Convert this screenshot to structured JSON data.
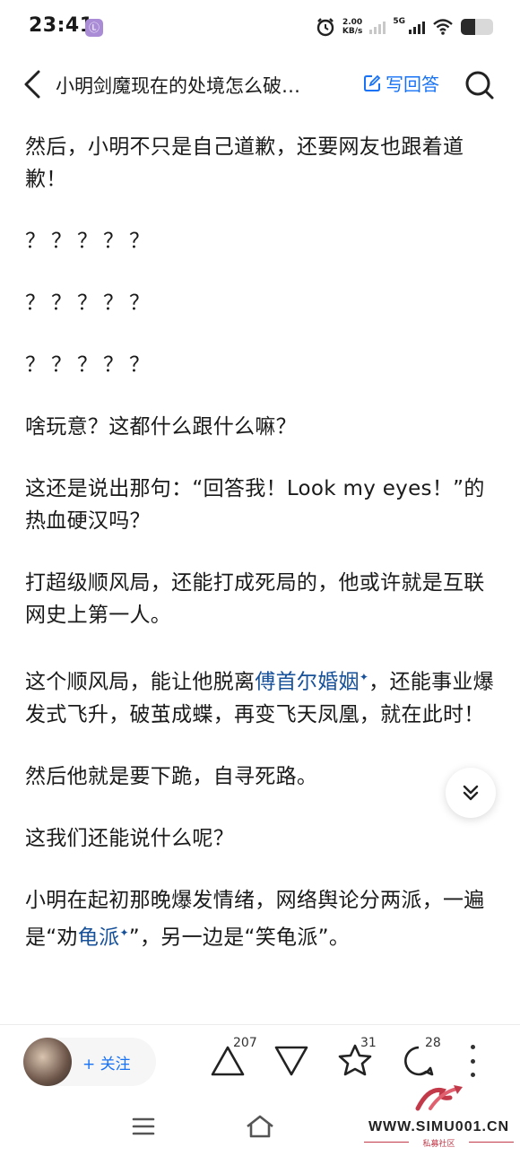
{
  "status_bar": {
    "time": "23:41",
    "app_badge": "Ⓛ",
    "net_speed_value": "2.00",
    "net_speed_unit": "KB/s",
    "network_type": "5G",
    "battery_level": 0.45
  },
  "header": {
    "title": "小明剑魔现在的处境怎么破…",
    "write_answer_label": "写回答"
  },
  "article": {
    "p1": "然后，小明不只是自己道歉，还要网友也跟着道歉！",
    "q1": "？？？？？",
    "q2": "？？？？？",
    "q3": "？？？？？",
    "p2": "啥玩意？这都什么跟什么嘛？",
    "p3": "这还是说出那句：“回答我！Look my eyes！”的热血硬汉吗？",
    "p4": "打超级顺风局，还能打成死局的，他或许就是互联网史上第一人。",
    "p5_a": "这个顺风局，能让他脱离",
    "p5_link": "傅首尔婚姻",
    "p5_b": "，还能事业爆发式飞升，破茧成蝶，再变飞天凤凰，就在此时！",
    "p6": "然后他就是要下跪，自寻死路。",
    "p7": "这我们还能说什么呢？",
    "p8_a": "小明在起初那晚爆发情绪，网络舆论分两派，一遍是“劝",
    "p8_link": "龟派",
    "p8_b": "”，另一边是“笑龟派”。",
    "spark_glyph": "✦"
  },
  "action_bar": {
    "follow_label": "+ 关注",
    "upvote_count": "207",
    "star_count": "31",
    "comment_count": "28"
  },
  "watermark": {
    "url": "WWW.SIMU001.CN",
    "subtitle": "私募社区"
  },
  "colors": {
    "accent": "#1772f6",
    "link": "#175199",
    "text": "#1a1a1a"
  }
}
